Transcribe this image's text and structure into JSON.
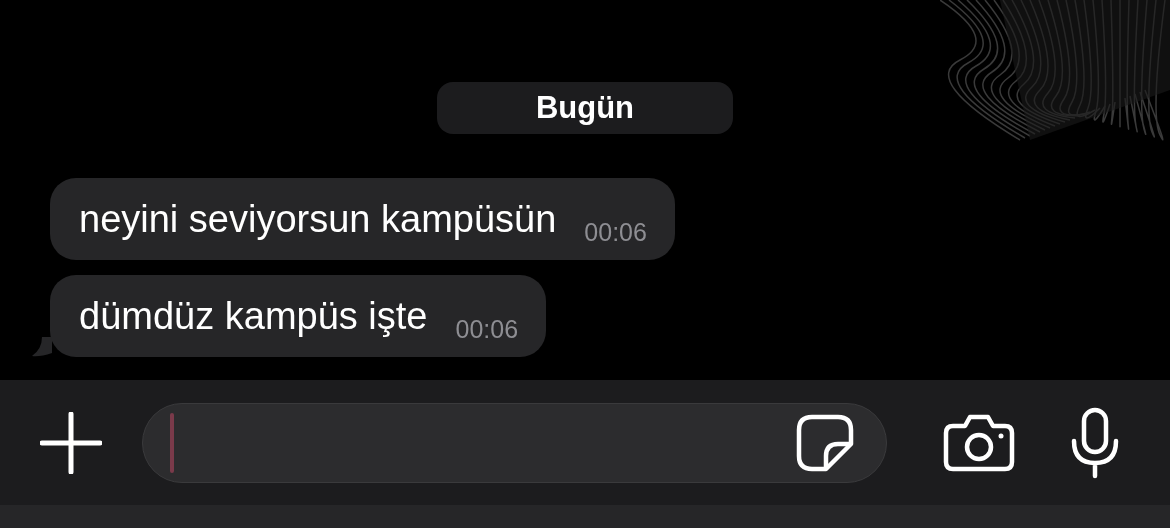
{
  "date_label": "Bugün",
  "messages": [
    {
      "text": "neyini seviyorsun kampüsün",
      "time": "00:06",
      "tail": false
    },
    {
      "text": "dümdüz kampüs işte",
      "time": "00:06",
      "tail": true
    }
  ],
  "composer": {
    "focused": true
  }
}
